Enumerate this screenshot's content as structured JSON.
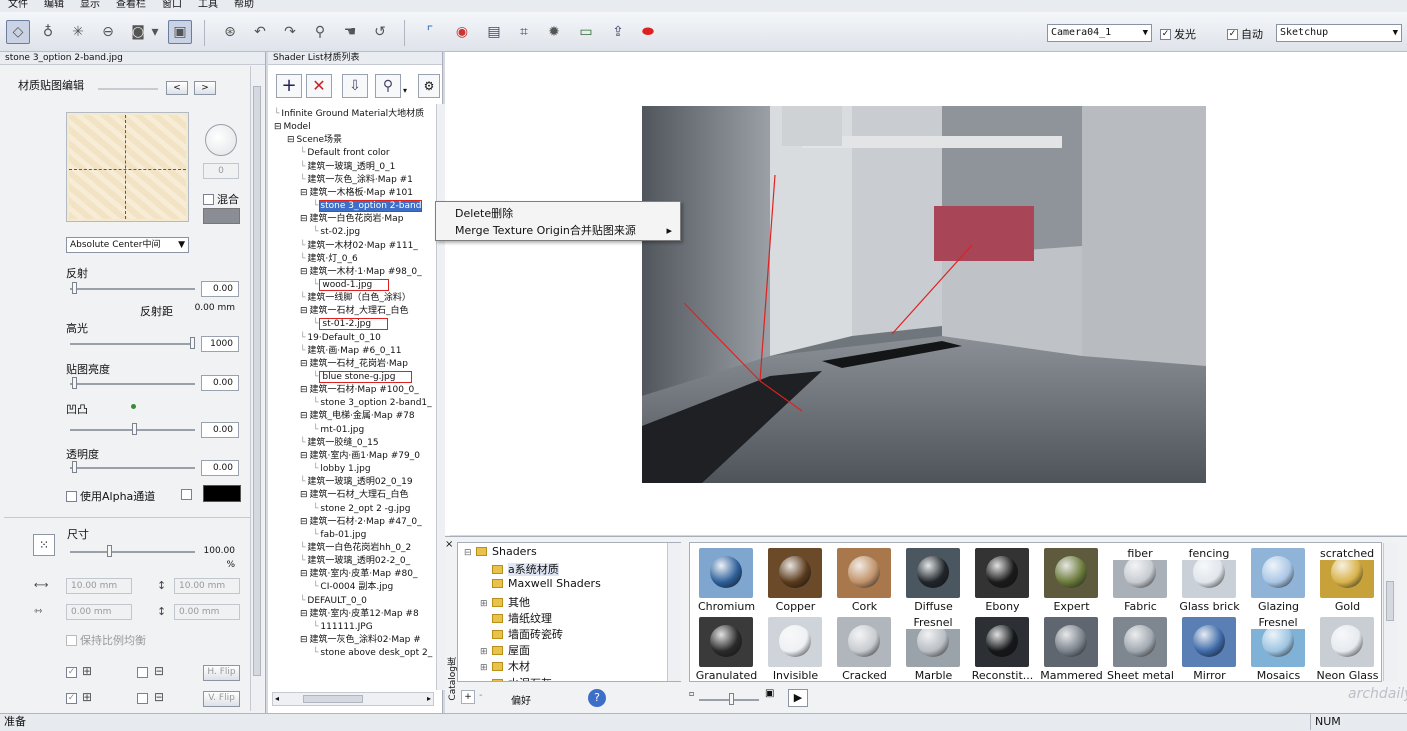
{
  "menu": [
    "文件",
    "编辑",
    "显示",
    "查看栏",
    "窗口",
    "工具",
    "帮助"
  ],
  "toolbar": {
    "camera_select": "Camera04_1",
    "glow_checkbox": {
      "label": "发光",
      "checked": true
    },
    "auto_checkbox": {
      "label": "自动",
      "checked": true
    },
    "mode_select": "Sketchup"
  },
  "left_panel": {
    "title": "stone 3_option 2-band.jpg",
    "section_title": "材质贴图编辑",
    "preview_value": "0",
    "blend_label": "混合",
    "mapping_select": "Absolute Center中间",
    "reflection_label": "反射",
    "reflection_value": "0.00",
    "reflection_distance_label": "反射距",
    "reflection_distance_value": "0.00 mm",
    "highlight_label": "高光",
    "highlight_value": "1000",
    "map_brightness_label": "贴图亮度",
    "map_brightness_value": "0.00",
    "bump_label": "凹凸",
    "bump_value": "0.00",
    "transparency_label": "透明度",
    "transparency_value": "0.00",
    "alpha_label": "使用Alpha通道",
    "size_label": "尺寸",
    "size_value": "100.00 %",
    "width_value": "10.00 mm",
    "height_value": "10.00 mm",
    "offset_x_value": "0.00 mm",
    "offset_y_value": "0.00 mm",
    "keep_ratio_label": "保持比例均衡",
    "hflip_label": "H. Flip",
    "vflip_label": "V. Flip"
  },
  "shader_panel": {
    "title": "Shader List材质列表",
    "tree": [
      {
        "text": "Infinite Ground Material大地材质",
        "indent": 0
      },
      {
        "text": "Model",
        "indent": 0,
        "toggle": "-"
      },
      {
        "text": "Scene场景",
        "indent": 1,
        "toggle": "-"
      },
      {
        "text": "Default front color",
        "indent": 2
      },
      {
        "text": "建筑一玻璃_透明_0_1",
        "indent": 2
      },
      {
        "text": "建筑一灰色_涂料·Map #1",
        "indent": 2
      },
      {
        "text": "建筑一木格板·Map #101",
        "indent": 2,
        "toggle": "-"
      },
      {
        "text": "stone 3_option 2-band",
        "indent": 3,
        "selected": true
      },
      {
        "text": "建筑一白色花岗岩·Map",
        "indent": 2,
        "toggle": "-"
      },
      {
        "text": "st-02.jpg",
        "indent": 3
      },
      {
        "text": "建筑一木材02·Map #111_",
        "indent": 2
      },
      {
        "text": "建筑·灯_0_6",
        "indent": 2
      },
      {
        "text": "建筑一木材·1·Map #98_0_",
        "indent": 2,
        "toggle": "-"
      },
      {
        "text": "wood-1.jpg",
        "indent": 3,
        "boxed": true
      },
      {
        "text": "建筑一线脚（白色_涂料）",
        "indent": 2
      },
      {
        "text": "建筑一石材_大理石_白色",
        "indent": 2,
        "toggle": "-"
      },
      {
        "text": "st-01-2.jpg",
        "indent": 3,
        "boxed": true
      },
      {
        "text": "19·Default_0_10",
        "indent": 2
      },
      {
        "text": "建筑·画·Map #6_0_11",
        "indent": 2
      },
      {
        "text": "建筑一石材_花岗岩·Map",
        "indent": 2,
        "toggle": "-"
      },
      {
        "text": "blue stone-g.jpg",
        "indent": 3,
        "boxed": true
      },
      {
        "text": "建筑一石材·Map #100_0_",
        "indent": 2,
        "toggle": "-"
      },
      {
        "text": "stone 3_option 2-band1_",
        "indent": 3
      },
      {
        "text": "建筑_电梯·金属·Map #78",
        "indent": 2,
        "toggle": "-"
      },
      {
        "text": "mt-01.jpg",
        "indent": 3
      },
      {
        "text": "建筑一胶缝_0_15",
        "indent": 2
      },
      {
        "text": "建筑·室内·画1·Map #79_0",
        "indent": 2,
        "toggle": "-"
      },
      {
        "text": "lobby 1.jpg",
        "indent": 3
      },
      {
        "text": "建筑一玻璃_透明02_0_19",
        "indent": 2
      },
      {
        "text": "建筑一石材_大理石_白色",
        "indent": 2,
        "toggle": "-"
      },
      {
        "text": "stone 2_opt 2 -g.jpg",
        "indent": 3
      },
      {
        "text": "建筑一石材·2·Map #47_0_",
        "indent": 2,
        "toggle": "-"
      },
      {
        "text": "fab-01.jpg",
        "indent": 3
      },
      {
        "text": "建筑一白色花岗岩hh_0_2",
        "indent": 2
      },
      {
        "text": "建筑一玻璃_透明02-2_0_",
        "indent": 2
      },
      {
        "text": "建筑·室内·皮革·Map #80_",
        "indent": 2,
        "toggle": "-"
      },
      {
        "text": "CI-0004 副本.jpg",
        "indent": 3
      },
      {
        "text": "DEFAULT_0_0",
        "indent": 2
      },
      {
        "text": "建筑·室内·皮革12·Map #8",
        "indent": 2,
        "toggle": "-"
      },
      {
        "text": "111111.JPG",
        "indent": 3
      },
      {
        "text": "建筑一灰色_涂料02·Map #",
        "indent": 2,
        "toggle": "-"
      },
      {
        "text": "stone above desk_opt 2_",
        "indent": 3
      }
    ]
  },
  "context_menu": {
    "items": [
      "Delete删除",
      "Merge Texture Origin合并贴图来源"
    ],
    "submenu_arrow": "▸"
  },
  "library": {
    "side_label": "Catalog库",
    "tree": [
      {
        "text": "Shaders",
        "toggle": "-",
        "indent": 0
      },
      {
        "text": "a系统材质",
        "indent": 1,
        "selected": true
      },
      {
        "text": "Maxwell Shaders",
        "indent": 1
      },
      {
        "text": "其他",
        "indent": 1,
        "toggle": "+"
      },
      {
        "text": "墙纸纹理",
        "indent": 1
      },
      {
        "text": "墙面砖瓷砖",
        "indent": 1
      },
      {
        "text": "屋面",
        "indent": 1,
        "toggle": "+"
      },
      {
        "text": "木材",
        "indent": 1,
        "toggle": "+"
      },
      {
        "text": "水泥石灰",
        "indent": 1
      }
    ],
    "favorites_label": "偏好",
    "shaders": [
      {
        "name": "Chromium",
        "bg": "#7fa6cf",
        "ball": "#2d5f99"
      },
      {
        "name": "Copper",
        "bg": "#6b4a2a",
        "ball": "#5a3a1c"
      },
      {
        "name": "Cork",
        "bg": "#a8784c",
        "ball": "#c0926a"
      },
      {
        "name": "Diffuse",
        "bg": "#4a5660",
        "ball": "#20262c"
      },
      {
        "name": "Ebony",
        "bg": "#333333",
        "ball": "#1a1a1a"
      },
      {
        "name": "Expert",
        "bg": "#5d5a3e",
        "ball": "#6a7a3a"
      },
      {
        "name": "Fabric",
        "bg": "#aab0b8",
        "ball": "#c8ccd2",
        "tag": "fiber"
      },
      {
        "name": "Glass brick",
        "bg": "#c9d0d8",
        "ball": "#e0e6ec",
        "tag": "fencing"
      },
      {
        "name": "Glazing",
        "bg": "#8fb4d8",
        "ball": "#a9c6e6"
      },
      {
        "name": "Gold",
        "bg": "#c7a13a",
        "ball": "#d8b24a",
        "tag": "scratched"
      },
      {
        "name": "Granulated",
        "bg": "#3a3a3a",
        "ball": "#2a2a2a"
      },
      {
        "name": "Invisible",
        "bg": "#cfd4da",
        "ball": "#eef1f4"
      },
      {
        "name": "Cracked",
        "bg": "#b0b6bc",
        "ball": "#c8ccd0"
      },
      {
        "name": "Marble",
        "bg": "#9aa2aa",
        "ball": "#b8bec4",
        "tag": "Fresnel"
      },
      {
        "name": "Reconstit...",
        "bg": "#2c2f34",
        "ball": "#15171a"
      },
      {
        "name": "Mammered",
        "bg": "#5f6670",
        "ball": "#7a828c"
      },
      {
        "name": "Sheet metal",
        "bg": "#7e8790",
        "ball": "#a0a8b0"
      },
      {
        "name": "Mirror",
        "bg": "#5a7fb4",
        "ball": "#3e6aa8"
      },
      {
        "name": "Mosaics",
        "bg": "#7fb2d6",
        "ball": "#9cc4e2",
        "tag": "Fresnel"
      },
      {
        "name": "Neon Glass",
        "bg": "#c8ced4",
        "ball": "#e6ebf0"
      }
    ]
  },
  "status": {
    "left": "准备",
    "right": "NUM"
  },
  "watermark": "archdaily"
}
